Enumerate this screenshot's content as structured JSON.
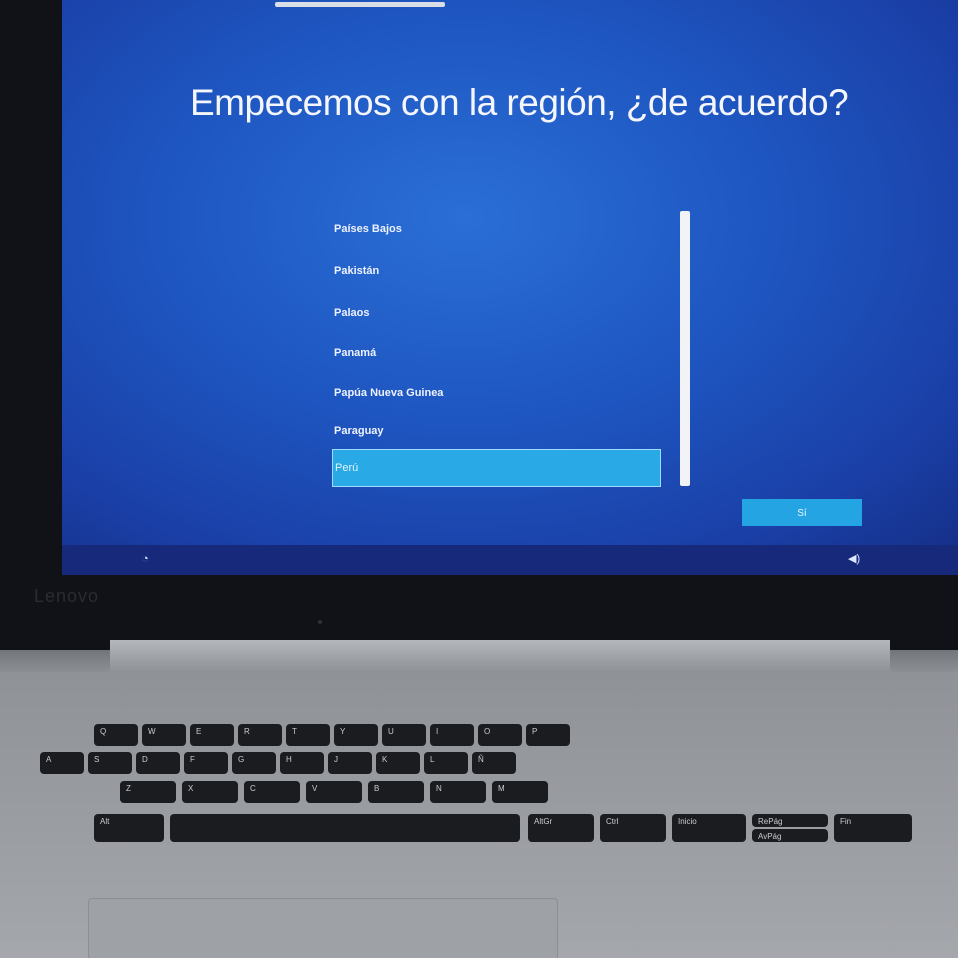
{
  "device": {
    "brand": "Lenovo"
  },
  "setup": {
    "title": "Empecemos con la región, ¿de acuerdo?",
    "regions": [
      "Países Bajos",
      "Pakistán",
      "Palaos",
      "Panamá",
      "Papúa Nueva Guinea",
      "Paraguay",
      "Perú"
    ],
    "selected": "Perú",
    "confirm_label": "Sí",
    "icons": {
      "left": "accessibility-icon",
      "right": "volume-icon"
    },
    "colors": {
      "background": "#1e55c0",
      "accent": "#29a9e6"
    }
  },
  "keyboard": {
    "row1": [
      "Q",
      "W",
      "E",
      "R",
      "T",
      "Y",
      "U",
      "I",
      "O",
      "P"
    ],
    "row2": [
      "A",
      "S",
      "D",
      "F",
      "G",
      "H",
      "J",
      "K",
      "L",
      "Ñ"
    ],
    "row3": [
      "Z",
      "X",
      "C",
      "V",
      "B",
      "N",
      "M"
    ],
    "row4": [
      "Alt",
      "AltGr",
      "Ctrl",
      "Inicio",
      "RePág",
      "AvPág",
      "Fin"
    ]
  }
}
